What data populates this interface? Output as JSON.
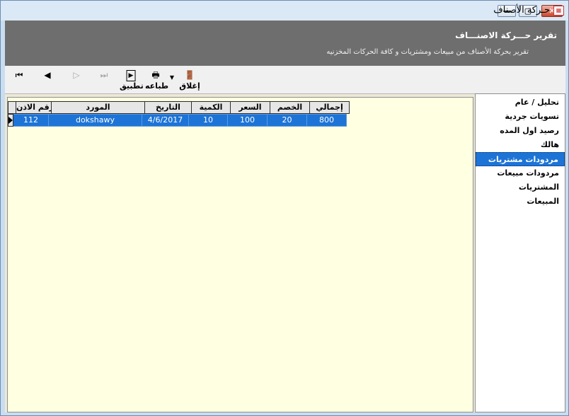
{
  "window": {
    "title": "حـركة الأصناف",
    "icon": "app-icon",
    "buttons": [
      "minimize",
      "maximize",
      "close"
    ]
  },
  "header": {
    "title": "تقرير حـــركة الاصنـــاف",
    "subtitle": "تقرير بحركة الأصناف من مبيعات ومشتريات و كافة الحركات المخزنيه"
  },
  "toolbar": {
    "close_label": "إغلاق",
    "print_label": "طباعه",
    "apply_label": "تطبيق",
    "nav_first": "first-record-icon",
    "nav_prev": "prev-record-icon",
    "nav_next": "next-record-icon",
    "nav_last": "last-record-icon"
  },
  "grid": {
    "columns": [
      "إجمالي",
      "الخصم",
      "السعر",
      "الكمية",
      "التاريخ",
      "المورد",
      "رقم الاذن"
    ],
    "rows": [
      [
        "800",
        "20",
        "100",
        "10",
        "4/6/2017",
        "dokshawy",
        "112"
      ]
    ]
  },
  "sidebar": {
    "items": [
      {
        "label": "تحليل / عام"
      },
      {
        "label": "تسويات جردية"
      },
      {
        "label": "رصيد اول المده"
      },
      {
        "label": "هالك"
      },
      {
        "label": "مردودات مشتريات",
        "selected": true
      },
      {
        "label": "مردودات مبيعات"
      },
      {
        "label": "المشتريات"
      },
      {
        "label": "المبيعات"
      }
    ]
  },
  "colors": {
    "selection": "#1d74d6",
    "header_band": "#6e6e6e",
    "grid_background": "#ffffe1"
  }
}
